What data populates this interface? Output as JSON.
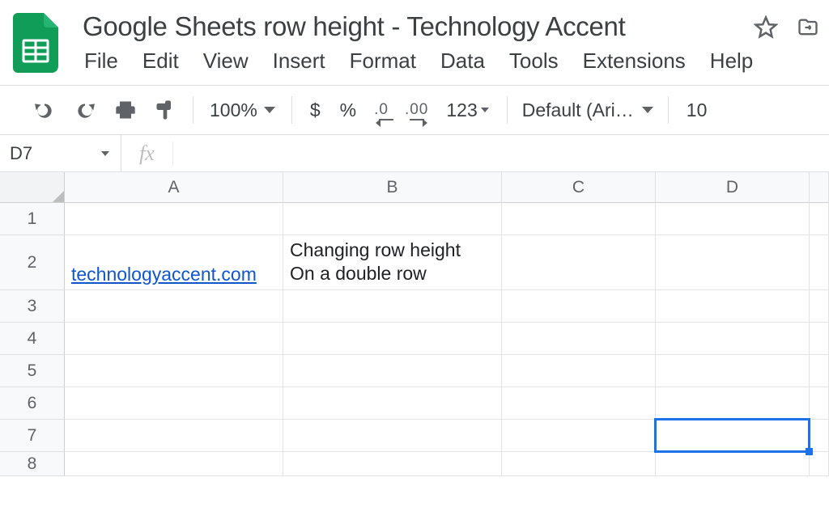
{
  "doc": {
    "title": "Google Sheets row height - Technology Accent"
  },
  "menu": {
    "items": [
      "File",
      "Edit",
      "View",
      "Insert",
      "Format",
      "Data",
      "Tools",
      "Extensions",
      "Help"
    ]
  },
  "toolbar": {
    "zoom": "100%",
    "currency": "$",
    "percent": "%",
    "dec_less": ".0",
    "dec_more": ".00",
    "numfmt": "123",
    "font": "Default (Ari…",
    "font_size": "10"
  },
  "namebox": {
    "ref": "D7"
  },
  "fx_label": "fx",
  "columns": [
    "A",
    "B",
    "C",
    "D"
  ],
  "rows": [
    "1",
    "2",
    "3",
    "4",
    "5",
    "6",
    "7",
    "8"
  ],
  "cells": {
    "A2": {
      "text": "technologyaccent.com",
      "link": true
    },
    "B2": {
      "text": "Changing row height\nOn a double row"
    }
  },
  "selection": "D7"
}
